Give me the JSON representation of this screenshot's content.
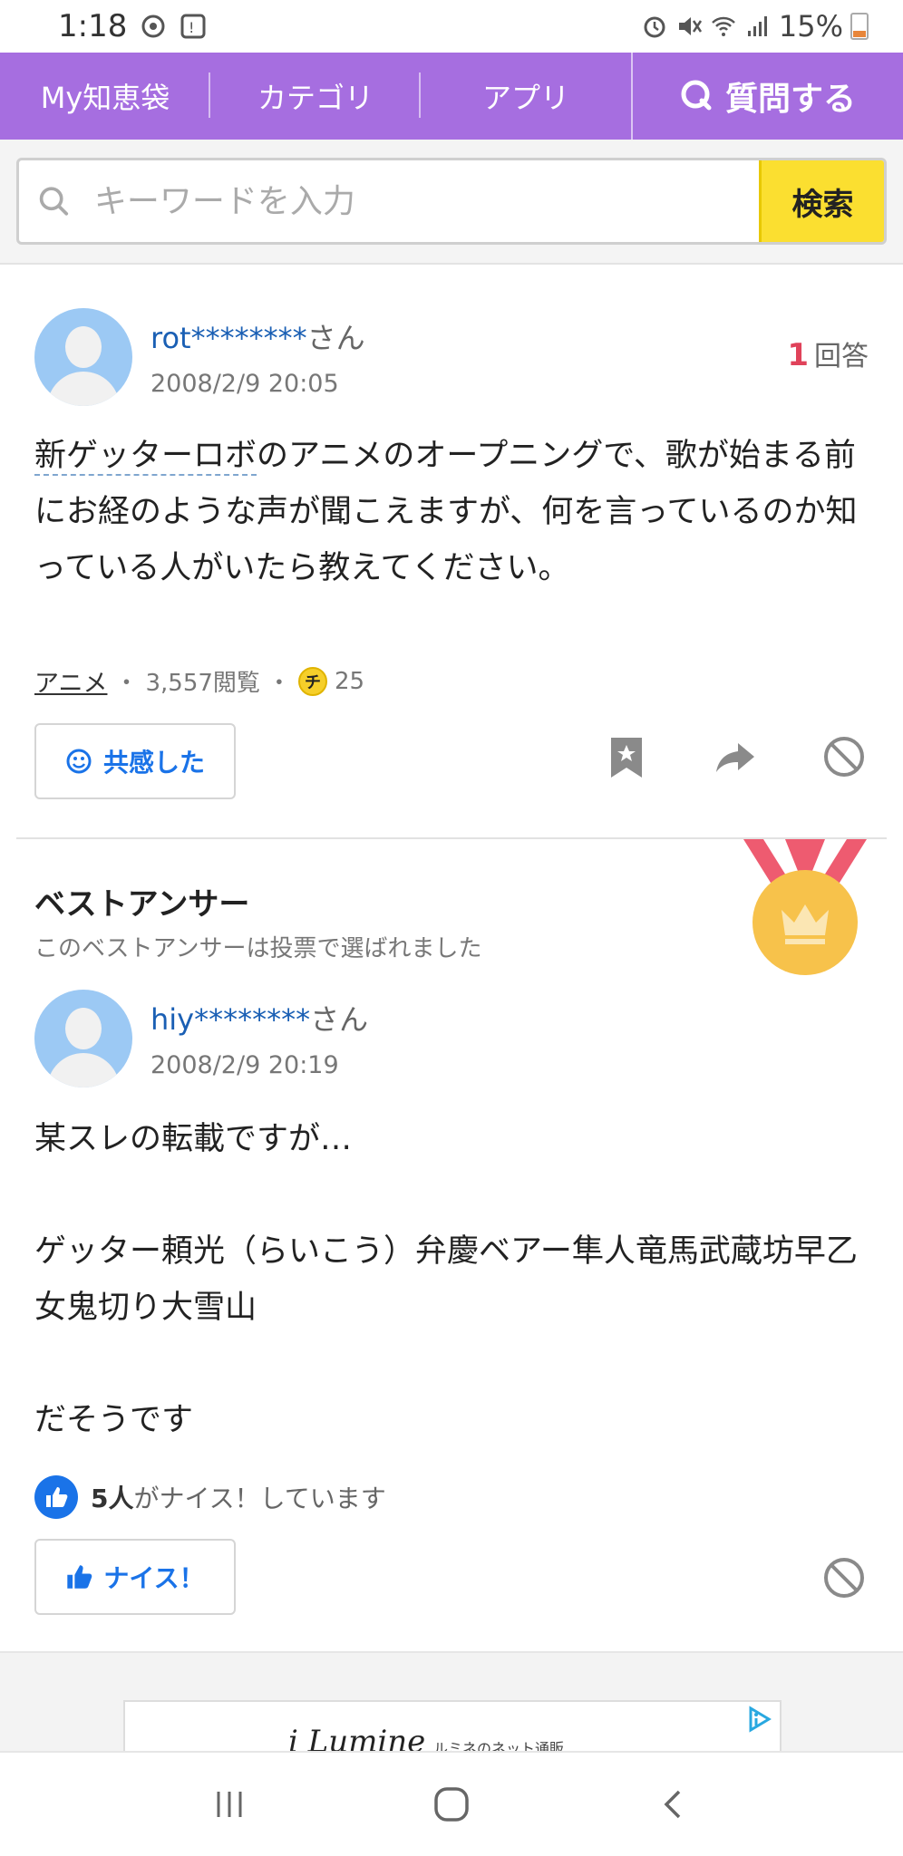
{
  "status_bar": {
    "time": "1:18",
    "battery": "15%"
  },
  "nav": {
    "my": "My知恵袋",
    "category": "カテゴリ",
    "app": "アプリ",
    "ask": "質問する"
  },
  "search": {
    "placeholder": "キーワードを入力",
    "button": "検索"
  },
  "question": {
    "user": "rot********",
    "honorific": "さん",
    "date": "2008/2/9 20:05",
    "answer_count": "1",
    "answer_label": "回答",
    "text_line1a": "新ゲッターロボ",
    "text_line1b": "のアニメのオープニングで、歌が始まる前にお経のような声が聞こえますが、何を言っているのか知っている人がいたら教えてください。",
    "category": "アニメ",
    "views": "3,557閲覧",
    "coin_label": "チ",
    "coins": "25",
    "empathy_button": "共感した"
  },
  "best_answer": {
    "title": "ベストアンサー",
    "subtitle": "このベストアンサーは投票で選ばれました",
    "user": "hiy********",
    "honorific": "さん",
    "date": "2008/2/9 20:19",
    "text": "某スレの転載ですが…\n\nゲッター頼光（らいこう）弁慶ベアー隼人竜馬武蔵坊早乙女鬼切り大雪山\n\nだそうです",
    "nice_count": "5人",
    "nice_text": "がナイス！しています",
    "nice_button": "ナイス！"
  },
  "ad": {
    "brand": "i Lumine",
    "tagline": "ルミネのネット通販"
  },
  "colors": {
    "nav_bg": "#a66ee0",
    "search_button": "#fbdf30",
    "link": "#1a5fb4",
    "accent_red": "#e0425a"
  }
}
